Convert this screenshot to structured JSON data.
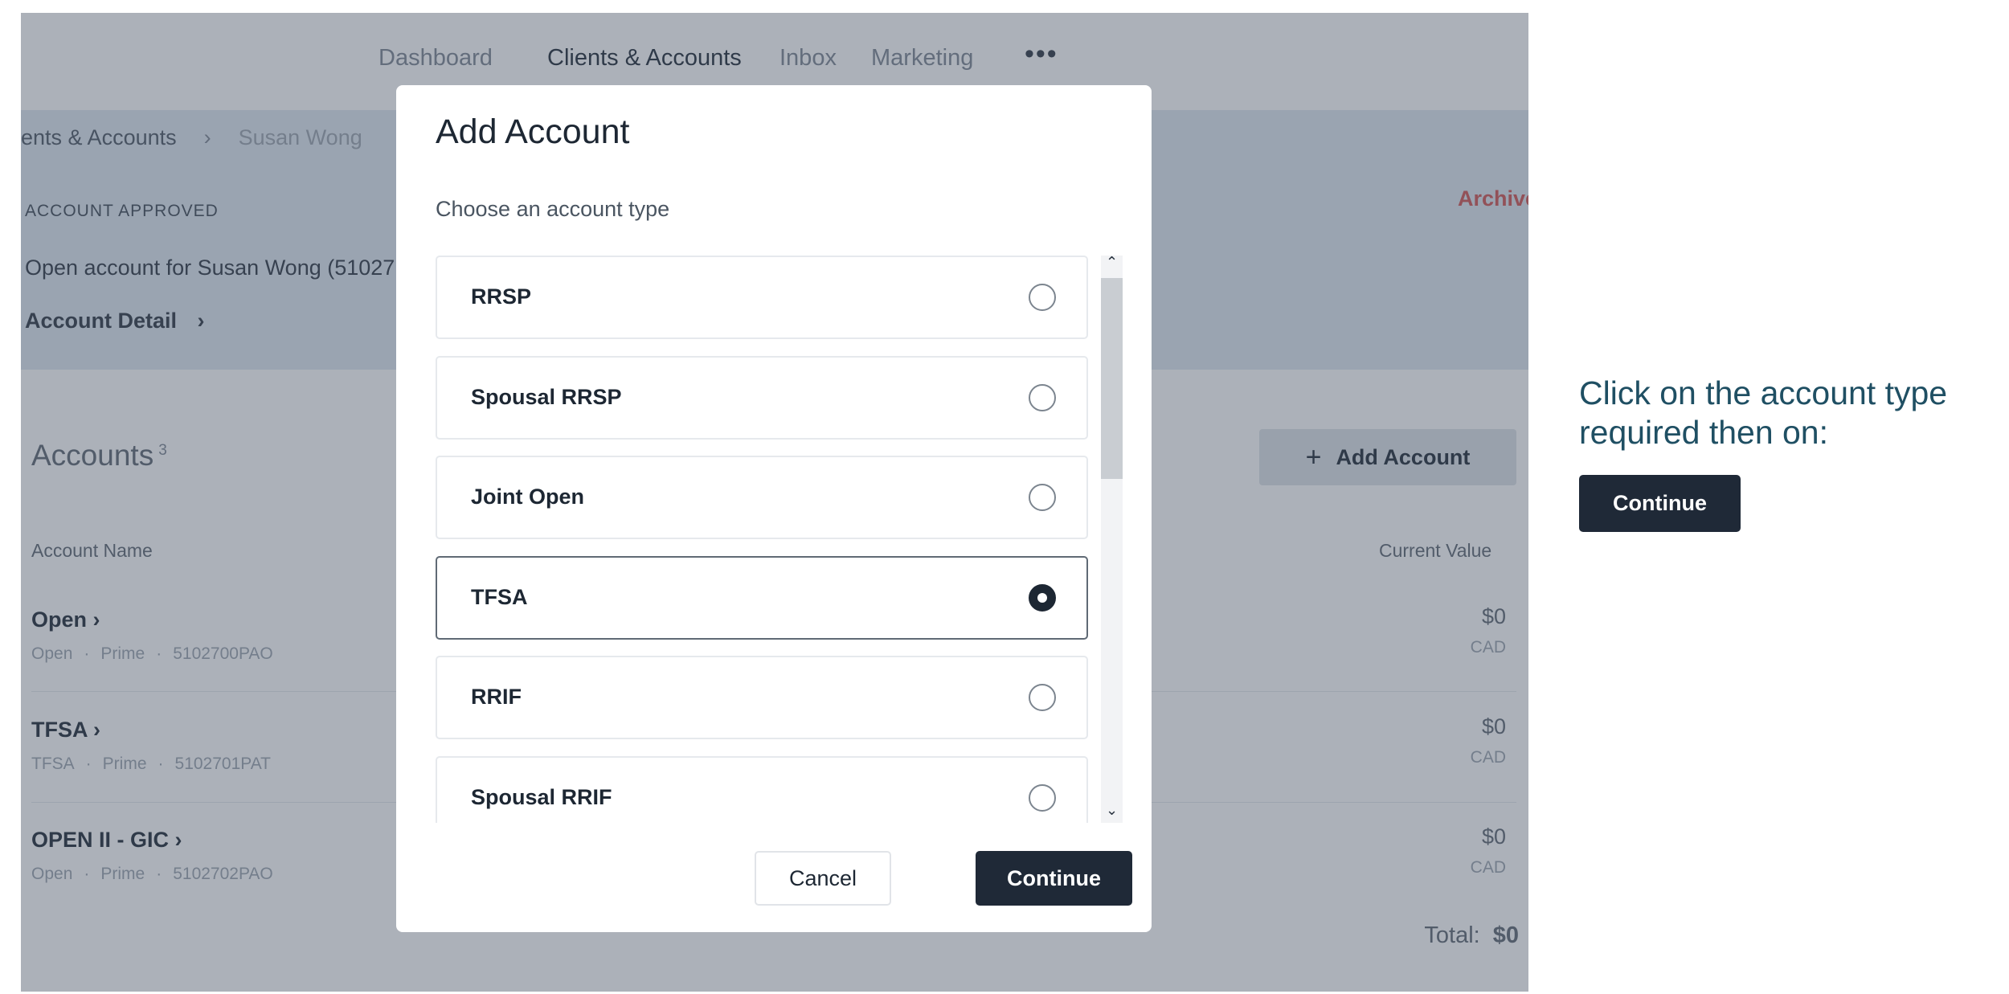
{
  "nav": {
    "items": [
      "Dashboard",
      "Clients & Accounts",
      "Inbox",
      "Marketing"
    ],
    "active": "Clients & Accounts",
    "more": "•••"
  },
  "breadcrumb": {
    "parent": "ents & Accounts",
    "separator": "›",
    "current": "Susan Wong"
  },
  "header": {
    "status": "ACCOUNT APPROVED",
    "open_for": "Open account for Susan Wong (51027",
    "detail_link": "Account Detail",
    "detail_chevron": "›",
    "archive": "Archive"
  },
  "accounts": {
    "title": "Accounts",
    "count": "3",
    "add_button": "Add Account",
    "add_icon": "+",
    "col_name": "Account Name",
    "col_value": "Current Value",
    "rows": [
      {
        "name": "Open",
        "meta": [
          "Open",
          "Prime",
          "5102700PAO"
        ],
        "value": "$0",
        "currency": "CAD"
      },
      {
        "name": "TFSA",
        "meta": [
          "TFSA",
          "Prime",
          "5102701PAT"
        ],
        "value": "$0",
        "currency": "CAD"
      },
      {
        "name": "OPEN II - GIC",
        "meta": [
          "Open",
          "Prime",
          "5102702PAO"
        ],
        "value": "$0",
        "currency": "CAD"
      }
    ],
    "total_label": "Total:",
    "total_value": "$0"
  },
  "modal": {
    "title": "Add Account",
    "subtitle": "Choose an account type",
    "options": [
      {
        "label": "RRSP",
        "selected": false
      },
      {
        "label": "Spousal RRSP",
        "selected": false
      },
      {
        "label": "Joint Open",
        "selected": false
      },
      {
        "label": "TFSA",
        "selected": true
      },
      {
        "label": "RRIF",
        "selected": false
      },
      {
        "label": "Spousal RRIF",
        "selected": false
      }
    ],
    "cancel": "Cancel",
    "continue": "Continue"
  },
  "instruction": {
    "text": "Click on the account type required then on:",
    "button": "Continue"
  },
  "colors": {
    "overlay": "#465264",
    "dark_button": "#1f2937",
    "archive_red": "#d0504f",
    "instruction_teal": "#1f4f63"
  }
}
